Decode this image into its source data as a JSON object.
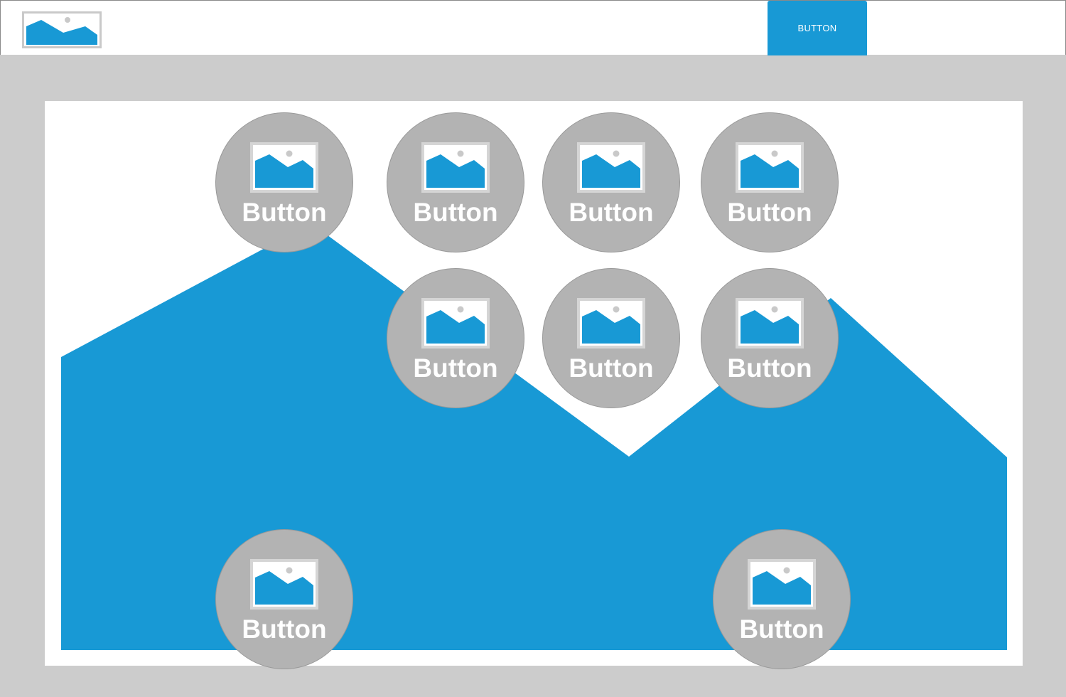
{
  "header": {
    "logo_icon": "image-placeholder-icon",
    "button_label": "BUTTON"
  },
  "colors": {
    "accent": "#1899d5",
    "page_background": "#cccccc",
    "circle_button": "#b3b3b3",
    "panel_background": "#ffffff"
  },
  "main": {
    "background_image_icon": "mountain-image-placeholder",
    "buttons": [
      {
        "label": "Button",
        "icon": "image-placeholder-icon"
      },
      {
        "label": "Button",
        "icon": "image-placeholder-icon"
      },
      {
        "label": "Button",
        "icon": "image-placeholder-icon"
      },
      {
        "label": "Button",
        "icon": "image-placeholder-icon"
      },
      {
        "label": "Button",
        "icon": "image-placeholder-icon"
      },
      {
        "label": "Button",
        "icon": "image-placeholder-icon"
      },
      {
        "label": "Button",
        "icon": "image-placeholder-icon"
      },
      {
        "label": "Button",
        "icon": "image-placeholder-icon"
      },
      {
        "label": "Button",
        "icon": "image-placeholder-icon"
      }
    ]
  }
}
